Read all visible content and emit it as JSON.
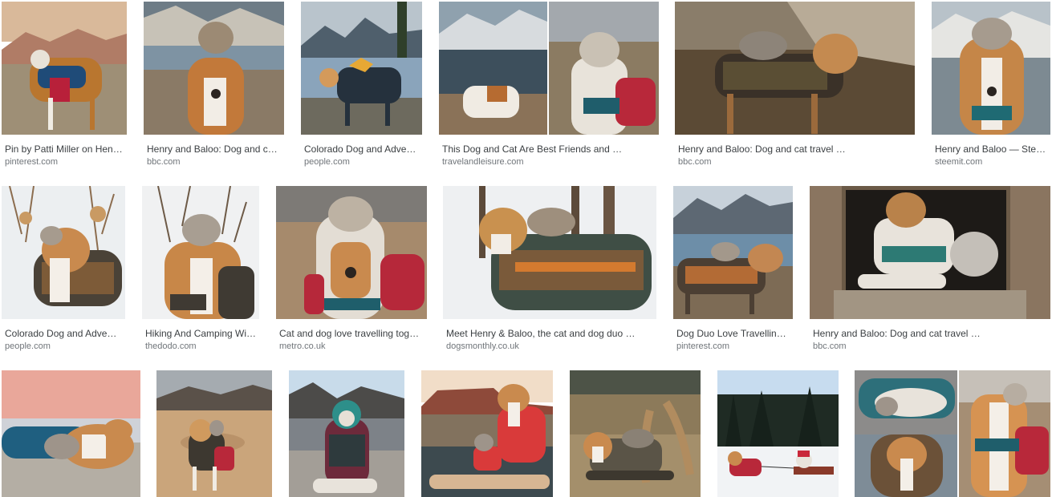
{
  "results": [
    {
      "title": "Pin by Patti Miller on Hen…",
      "source": "pinterest.com",
      "image": "dog-and-cat-mountain-photo"
    },
    {
      "title": "Henry and Baloo: Dog and ca…",
      "source": "bbc.com",
      "image": "cat-on-dog-head-lake-photo"
    },
    {
      "title": "Colorado Dog and Adve…",
      "source": "people.com",
      "image": "dog-in-jacket-lake-photo"
    },
    {
      "title": "This Dog and Cat Are Best Friends and …",
      "source": "travelandleisure.com",
      "image": "dog-cat-collage-photo"
    },
    {
      "title": "Henry and Baloo: Dog and cat travel …",
      "source": "bbc.com",
      "image": "cat-on-dog-back-photo"
    },
    {
      "title": "Henry and Baloo — Stee…",
      "source": "steemit.com",
      "image": "cat-on-dog-head-photo"
    },
    {
      "title": "Colorado Dog and Adve…",
      "source": "people.com",
      "image": "dog-cat-snow-photo"
    },
    {
      "title": "Hiking And Camping Wi…",
      "source": "thedodo.com",
      "image": "dog-cat-snow-branches-photo"
    },
    {
      "title": "Cat and dog love travelling tog…",
      "source": "metro.co.uk",
      "image": "cat-on-dog-head-dunes-photo"
    },
    {
      "title": "Meet Henry & Baloo, the cat and dog duo …",
      "source": "dogsmonthly.co.uk",
      "image": "dog-cat-snow-forest-photo"
    },
    {
      "title": "Dog Duo Love Travelling…",
      "source": "pinterest.com",
      "image": "dog-cat-lake-mountains-photo"
    },
    {
      "title": "Henry and Baloo: Dog and cat travel …",
      "source": "bbc.com",
      "image": "dog-cat-cabin-window-photo"
    },
    {
      "title": "",
      "source": "",
      "image": "dog-cat-sleeping-sunset-photo"
    },
    {
      "title": "",
      "source": "",
      "image": "dog-cat-desert-photo"
    },
    {
      "title": "",
      "source": "",
      "image": "dog-in-jacket-rocks-photo"
    },
    {
      "title": "",
      "source": "",
      "image": "dog-cat-paddleboard-photo"
    },
    {
      "title": "",
      "source": "",
      "image": "dog-cat-grass-photo"
    },
    {
      "title": "",
      "source": "",
      "image": "dog-sled-snow-forest-photo"
    },
    {
      "title": "",
      "source": "",
      "image": "dog-cat-collage-2-photo"
    }
  ],
  "colors": {
    "title_text": "#3c4043",
    "source_text": "#70757a"
  }
}
